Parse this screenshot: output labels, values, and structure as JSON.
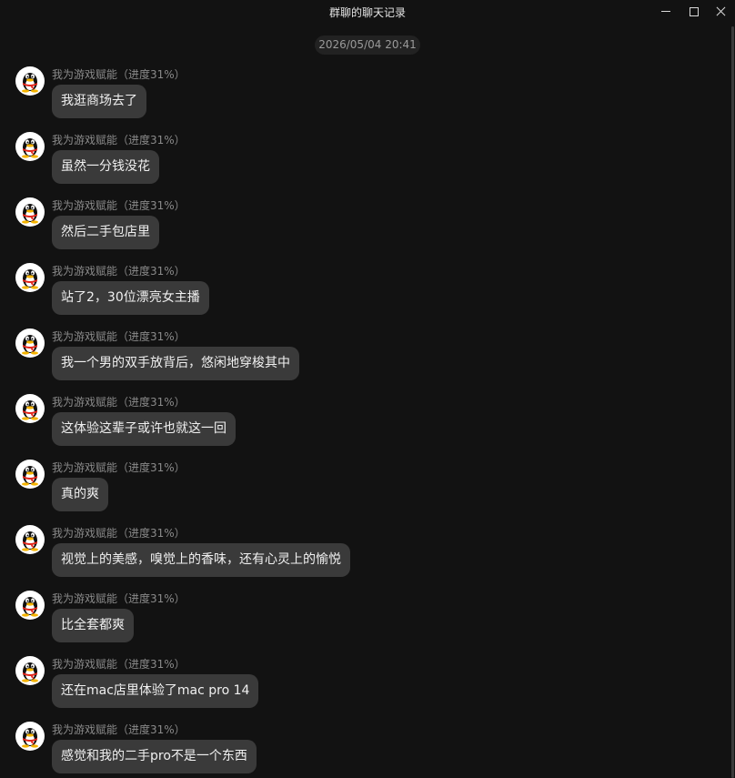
{
  "window": {
    "title": "群聊的聊天记录"
  },
  "date_separator": "2026/05/04 20:41",
  "messages": [
    {
      "sender": "我为游戏赋能（进度31%）",
      "text": "我逛商场去了"
    },
    {
      "sender": "我为游戏赋能（进度31%）",
      "text": "虽然一分钱没花"
    },
    {
      "sender": "我为游戏赋能（进度31%）",
      "text": "然后二手包店里"
    },
    {
      "sender": "我为游戏赋能（进度31%）",
      "text": "站了2，30位漂亮女主播"
    },
    {
      "sender": "我为游戏赋能（进度31%）",
      "text": "我一个男的双手放背后，悠闲地穿梭其中"
    },
    {
      "sender": "我为游戏赋能（进度31%）",
      "text": "这体验这辈子或许也就这一回"
    },
    {
      "sender": "我为游戏赋能（进度31%）",
      "text": "真的爽"
    },
    {
      "sender": "我为游戏赋能（进度31%）",
      "text": "视觉上的美感，嗅觉上的香味，还有心灵上的愉悦"
    },
    {
      "sender": "我为游戏赋能（进度31%）",
      "text": "比全套都爽"
    },
    {
      "sender": "我为游戏赋能（进度31%）",
      "text": "还在mac店里体验了mac pro 14"
    },
    {
      "sender": "我为游戏赋能（进度31%）",
      "text": "感觉和我的二手pro不是一个东西"
    }
  ],
  "icons": {
    "avatar": "qq-penguin-avatar",
    "minimize": "minimize-icon",
    "maximize": "maximize-icon",
    "close": "close-icon"
  },
  "colors": {
    "background": "#121212",
    "bubble": "#3a3a3a",
    "sender_text": "#8a8a8a",
    "message_text": "#f0f0f0"
  }
}
